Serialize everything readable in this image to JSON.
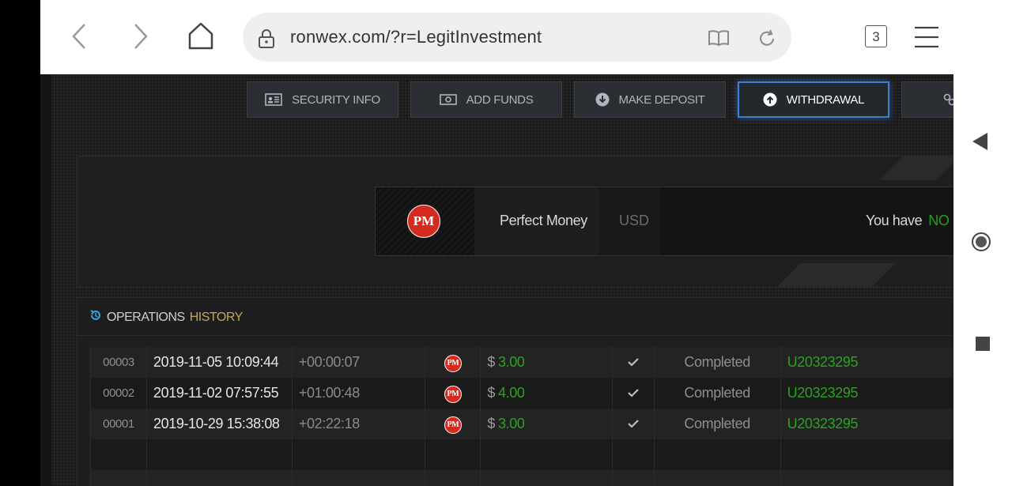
{
  "browser": {
    "url": "ronwex.com/?r=LegitInvestment",
    "tabs_count": "3",
    "icons": [
      "back-icon",
      "forward-icon",
      "home-icon",
      "lock-icon",
      "reader-icon",
      "reload-icon",
      "menu-icon"
    ]
  },
  "system_nav": {
    "icons": [
      "nav-back-icon",
      "nav-home-icon",
      "nav-recent-icon"
    ]
  },
  "menu": {
    "security": "SECURITY INFO",
    "add_funds": "ADD FUNDS",
    "make_deposit": "MAKE DEPOSIT",
    "withdrawal": "WITHDRAWAL"
  },
  "payment": {
    "logo": "PM",
    "name": "Perfect Money",
    "currency": "USD",
    "you_have": "You have",
    "no_funds": "NO FU"
  },
  "operations": {
    "title_main": "OPERATIONS",
    "title_accent": "HISTORY",
    "rows": [
      {
        "id": "00003",
        "date": "2019-11-05 10:09:44",
        "diff": "+00:00:07",
        "pm": "PM",
        "currency": "$",
        "amount": "3.00",
        "status": "Completed",
        "account": "U20323295"
      },
      {
        "id": "00002",
        "date": "2019-11-02 07:57:55",
        "diff": "+01:00:48",
        "pm": "PM",
        "currency": "$",
        "amount": "4.00",
        "status": "Completed",
        "account": "U20323295"
      },
      {
        "id": "00001",
        "date": "2019-10-29 15:38:08",
        "diff": "+02:22:18",
        "pm": "PM",
        "currency": "$",
        "amount": "3.00",
        "status": "Completed",
        "account": "U20323295"
      }
    ]
  },
  "colors": {
    "accent_blue": "#3d7fd6",
    "money_green": "#2aa320",
    "history_gold": "#c5a55a",
    "pm_red": "#d62a1f"
  }
}
